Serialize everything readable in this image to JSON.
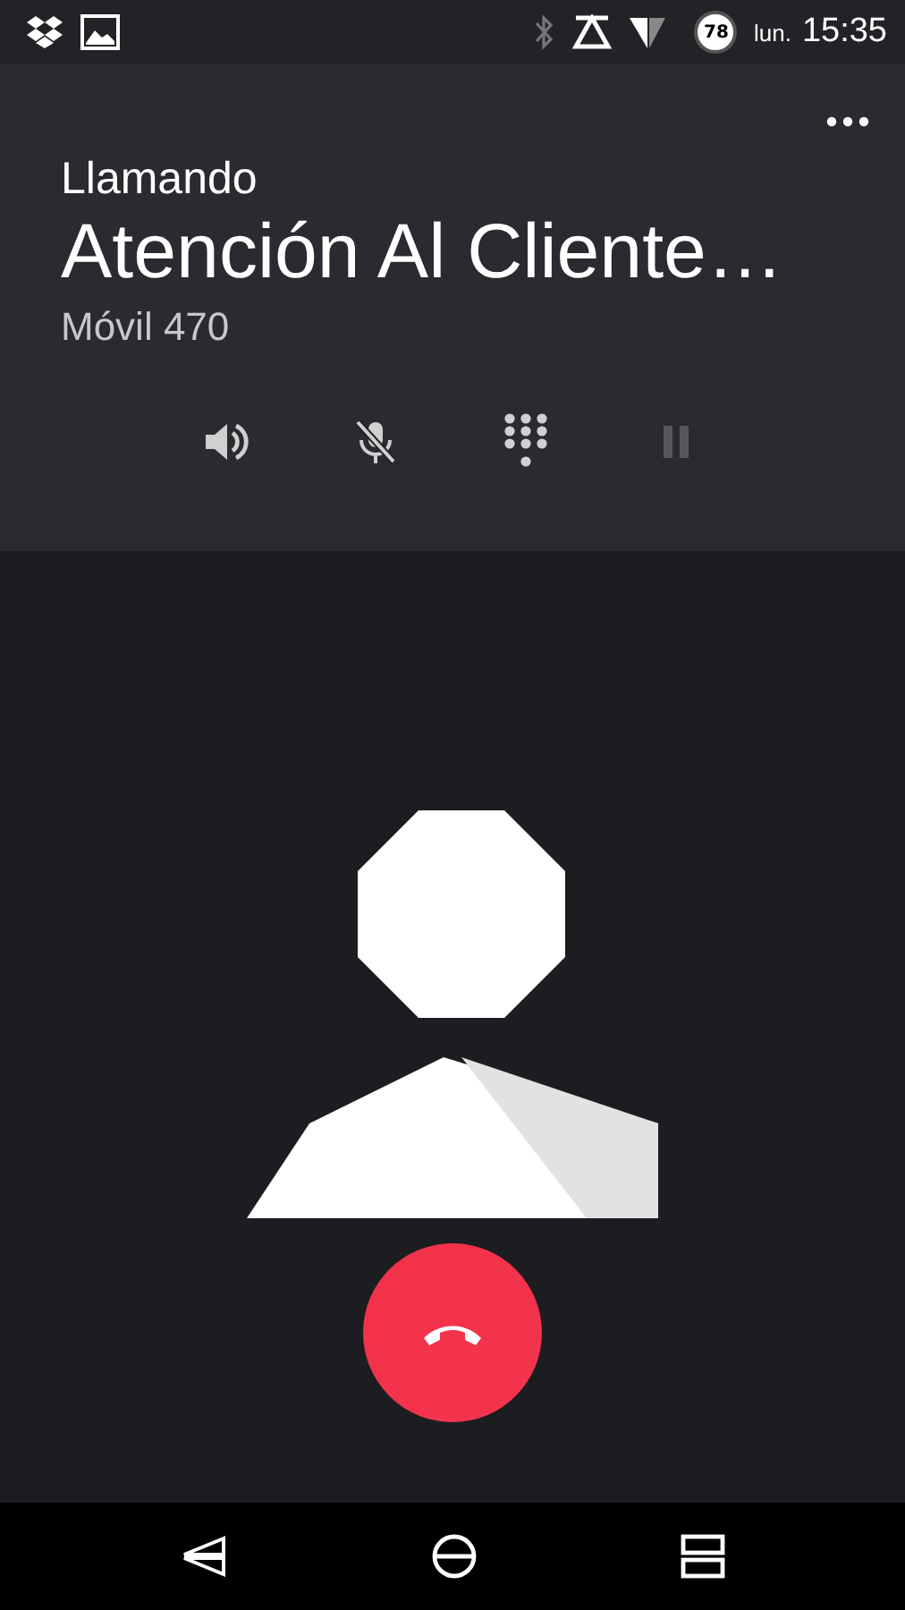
{
  "status_bar": {
    "day": "lun.",
    "time": "15:35",
    "battery": "78"
  },
  "call": {
    "state": "Llamando",
    "name": "Atención Al Cliente…",
    "number": "Móvil 470"
  },
  "controls": [
    {
      "kind": "speaker",
      "disabled": false
    },
    {
      "kind": "mute",
      "disabled": false
    },
    {
      "kind": "dialpad",
      "disabled": false
    },
    {
      "kind": "hold",
      "disabled": true
    }
  ]
}
